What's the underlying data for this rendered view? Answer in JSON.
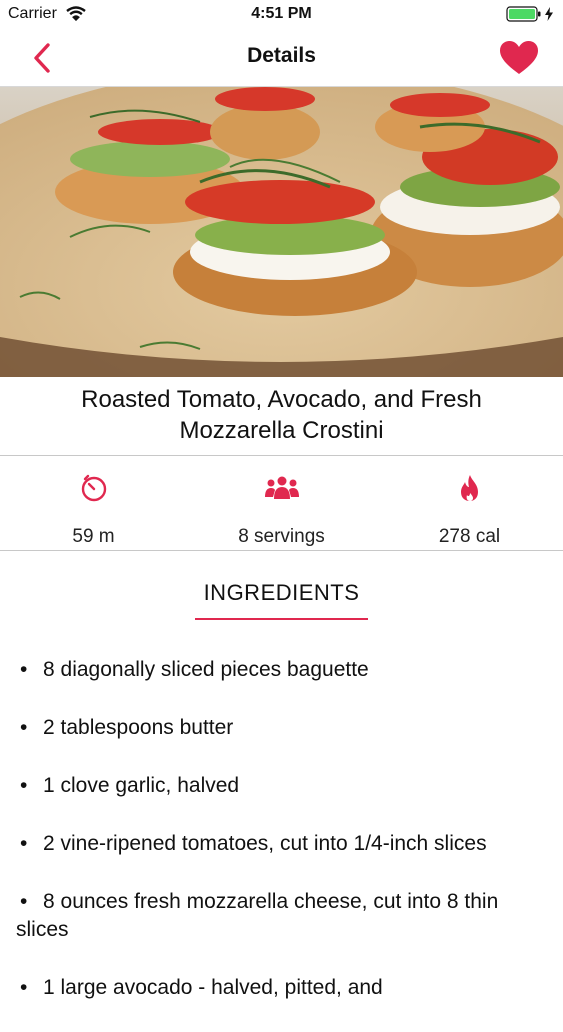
{
  "status_bar": {
    "carrier": "Carrier",
    "time": "4:51 PM"
  },
  "nav": {
    "title": "Details"
  },
  "recipe": {
    "title": "Roasted Tomato, Avocado, and Fresh Mozzarella Crostini",
    "stats": {
      "time": "59 m",
      "servings": "8 servings",
      "calories": "278 cal"
    }
  },
  "ingredients": {
    "header": "INGREDIENTS",
    "bullet": "•",
    "items": [
      "8 diagonally sliced pieces baguette",
      "2 tablespoons butter",
      "1 clove garlic, halved",
      "2 vine-ripened tomatoes, cut into 1/4-inch slices",
      "8 ounces fresh mozzarella cheese, cut into 8 thin slices",
      "1 large avocado - halved, pitted, and"
    ]
  },
  "colors": {
    "accent": "#e0284f",
    "battery": "#4cd964"
  },
  "icons": {
    "back": "chevron-left-icon",
    "favorite": "heart-icon",
    "time": "stopwatch-icon",
    "servings": "people-icon",
    "calories": "flame-icon"
  }
}
